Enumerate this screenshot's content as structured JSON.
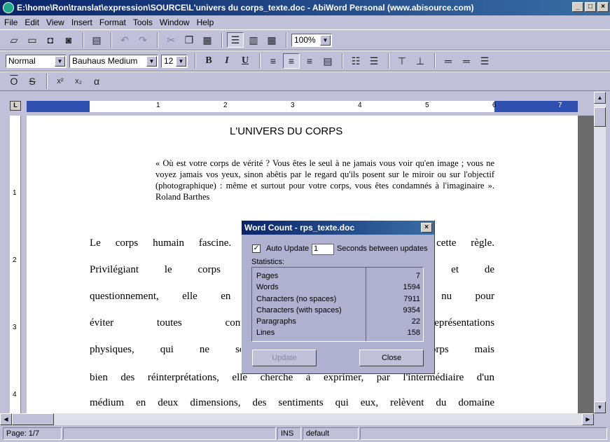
{
  "window": {
    "title": "E:\\home\\Ron\\translat\\expression\\SOURCE\\L'univers du corps_texte.doc - AbiWord Personal (www.abisource.com)"
  },
  "menu": [
    "File",
    "Edit",
    "View",
    "Insert",
    "Format",
    "Tools",
    "Window",
    "Help"
  ],
  "toolbar": {
    "zoom": "100%",
    "style": "Normal",
    "font": "Bauhaus Medium",
    "size": "12"
  },
  "ruler": {
    "h_numbers": [
      "1",
      "2",
      "3",
      "4",
      "5",
      "6",
      "7"
    ],
    "v_numbers": [
      "1",
      "2",
      "3",
      "4"
    ]
  },
  "document": {
    "title": "L'UNIVERS DU CORPS",
    "quote": "« Où est votre corps de vérité ? Vous êtes le seul à ne jamais vous voir qu'en image ; vous ne voyez jamais vos yeux, sinon abêtis par le regard qu'ils posent sur le miroir ou sur l'objectif (photographique) : même et surtout pour votre corps, vous êtes condamnés à l'imaginaire ». Roland Barthes",
    "lines": [
      "Le corps humain fascine. L'art ne fait pas exception à cette règle.",
      "Privilégiant le corps comme sujet de recherche et de",
      "questionnement, elle en fait un sujet de l'art nu pour",
      "éviter toutes connotations ni des représentations",
      "physiques, qui ne sont pas exactement le corps mais",
      "bien des réinterprétations, elle cherche à exprimer, par l'intermédiaire d'un",
      "médium en deux dimensions, des sentiments qui eux, relèvent du domaine"
    ]
  },
  "status": {
    "page": "Page: 1/7",
    "mode": "INS",
    "lang": "default"
  },
  "dialog": {
    "title": "Word Count - rps_texte.doc",
    "auto_update_label": "Auto Update",
    "auto_update_checked": true,
    "interval": "1",
    "interval_label": "Seconds between updates",
    "stats_label": "Statistics:",
    "stats": [
      {
        "label": "Pages",
        "value": "7"
      },
      {
        "label": "Words",
        "value": "1594"
      },
      {
        "label": "Characters (no spaces)",
        "value": "7911"
      },
      {
        "label": "Characters (with spaces)",
        "value": "9354"
      },
      {
        "label": "Paragraphs",
        "value": "22"
      },
      {
        "label": "Lines",
        "value": "158"
      }
    ],
    "update_button": "Update",
    "close_button": "Close"
  }
}
